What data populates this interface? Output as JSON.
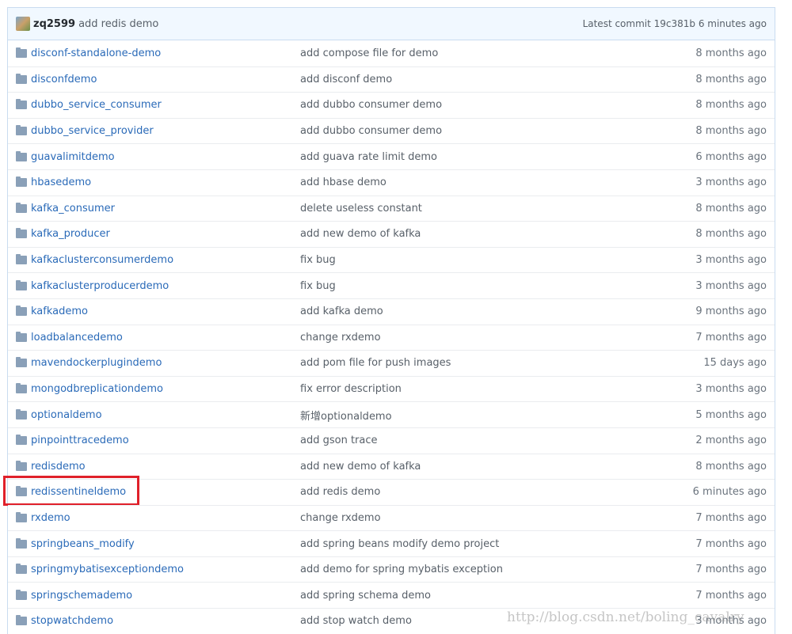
{
  "header": {
    "user": "zq2599",
    "message": "add redis demo",
    "latest_commit": "Latest commit 19c381b 6 minutes ago"
  },
  "highlighted": "redissentineldemo",
  "rows": [
    {
      "name": "disconf-standalone-demo",
      "message": "add compose file for demo",
      "age": "8 months ago"
    },
    {
      "name": "disconfdemo",
      "message": "add disconf demo",
      "age": "8 months ago"
    },
    {
      "name": "dubbo_service_consumer",
      "message": "add dubbo consumer demo",
      "age": "8 months ago"
    },
    {
      "name": "dubbo_service_provider",
      "message": "add dubbo consumer demo",
      "age": "8 months ago"
    },
    {
      "name": "guavalimitdemo",
      "message": "add guava rate limit demo",
      "age": "6 months ago"
    },
    {
      "name": "hbasedemo",
      "message": "add hbase demo",
      "age": "3 months ago"
    },
    {
      "name": "kafka_consumer",
      "message": "delete useless constant",
      "age": "8 months ago"
    },
    {
      "name": "kafka_producer",
      "message": "add new demo of kafka",
      "age": "8 months ago"
    },
    {
      "name": "kafkaclusterconsumerdemo",
      "message": "fix bug",
      "age": "3 months ago"
    },
    {
      "name": "kafkaclusterproducerdemo",
      "message": "fix bug",
      "age": "3 months ago"
    },
    {
      "name": "kafkademo",
      "message": "add kafka demo",
      "age": "9 months ago"
    },
    {
      "name": "loadbalancedemo",
      "message": "change rxdemo",
      "age": "7 months ago"
    },
    {
      "name": "mavendockerplugindemo",
      "message": "add pom file for push images",
      "age": "15 days ago"
    },
    {
      "name": "mongodbreplicationdemo",
      "message": "fix error description",
      "age": "3 months ago"
    },
    {
      "name": "optionaldemo",
      "message": "新增optionaldemo",
      "age": "5 months ago"
    },
    {
      "name": "pinpointtracedemo",
      "message": "add gson trace",
      "age": "2 months ago"
    },
    {
      "name": "redisdemo",
      "message": "add new demo of kafka",
      "age": "8 months ago"
    },
    {
      "name": "redissentineldemo",
      "message": "add redis demo",
      "age": "6 minutes ago"
    },
    {
      "name": "rxdemo",
      "message": "change rxdemo",
      "age": "7 months ago"
    },
    {
      "name": "springbeans_modify",
      "message": "add spring beans modify demo project",
      "age": "7 months ago"
    },
    {
      "name": "springmybatisexceptiondemo",
      "message": "add demo for spring mybatis exception",
      "age": "7 months ago"
    },
    {
      "name": "springschemademo",
      "message": "add spring schema demo",
      "age": "7 months ago"
    },
    {
      "name": "stopwatchdemo",
      "message": "add stop watch demo",
      "age": "3 months ago"
    }
  ],
  "watermark": "http://blog.csdn.net/boling_cavalry"
}
